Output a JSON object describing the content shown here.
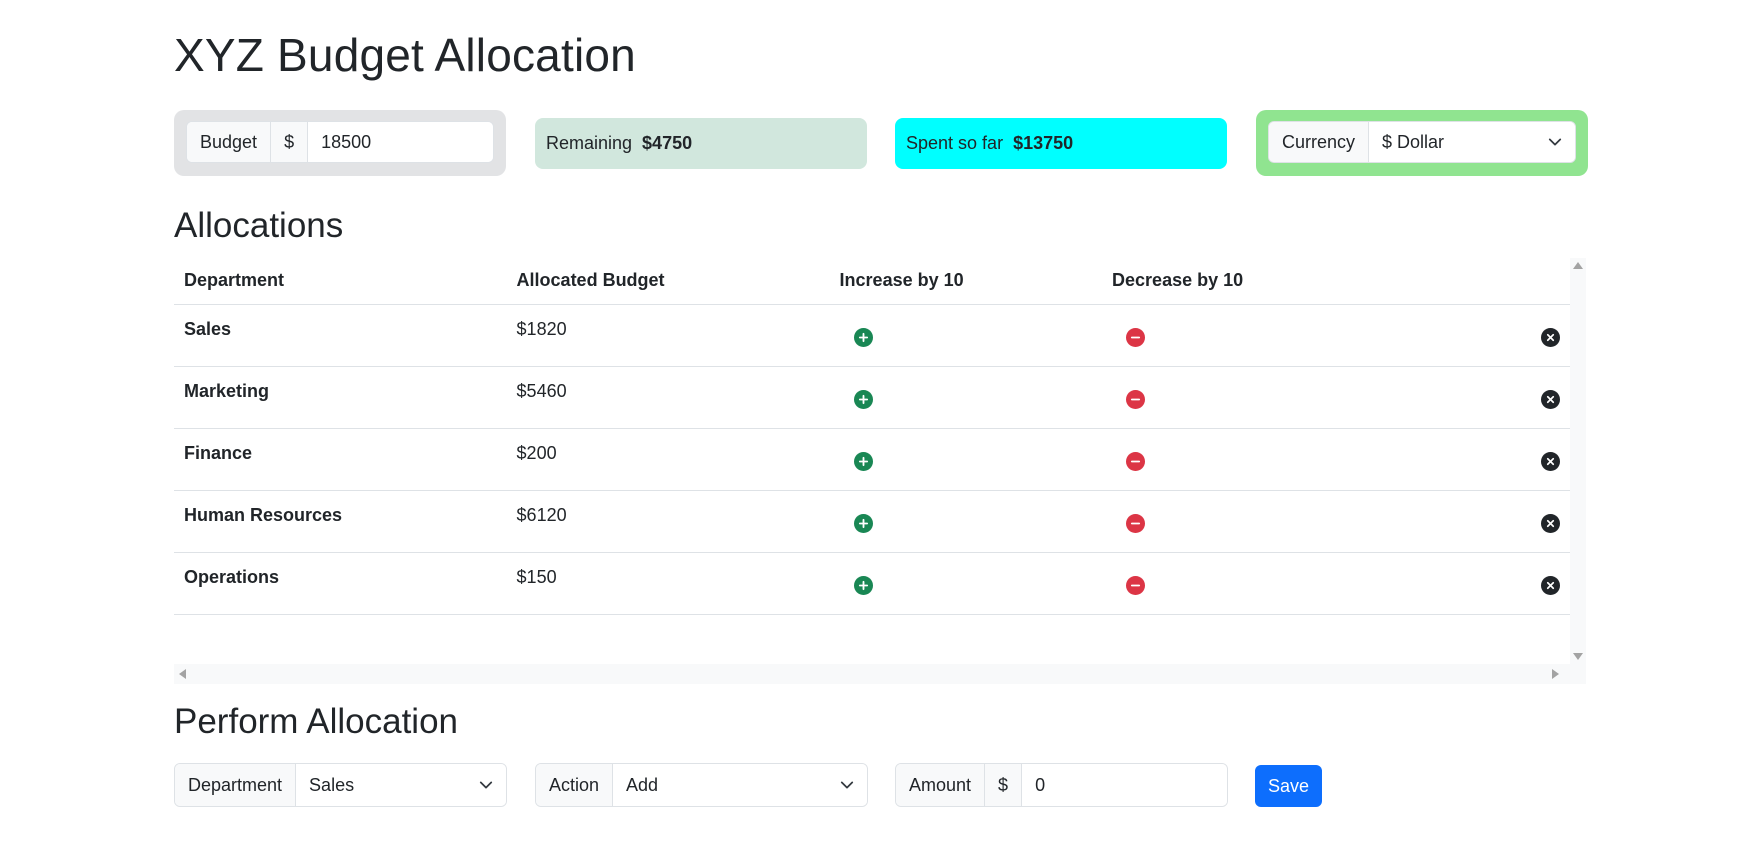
{
  "page": {
    "title": "XYZ Budget Allocation"
  },
  "summary": {
    "budget": {
      "label": "Budget",
      "prefix": "$",
      "value": "18500"
    },
    "remaining": {
      "label": "Remaining",
      "value": "$4750",
      "color": "#d1e7dd"
    },
    "spent": {
      "label": "Spent so far",
      "value": "$13750",
      "color": "#00ffff"
    },
    "currency": {
      "label": "Currency",
      "selected": "$ Dollar",
      "color": "#90e490"
    }
  },
  "allocations": {
    "title": "Allocations",
    "columns": [
      "Department",
      "Allocated Budget",
      "Increase by 10",
      "Decrease by 10"
    ],
    "rows": [
      {
        "department": "Sales",
        "amount": "$1820"
      },
      {
        "department": "Marketing",
        "amount": "$5460"
      },
      {
        "department": "Finance",
        "amount": "$200"
      },
      {
        "department": "Human Resources",
        "amount": "$6120"
      },
      {
        "department": "Operations",
        "amount": "$150"
      }
    ]
  },
  "perform": {
    "title": "Perform Allocation",
    "department": {
      "label": "Department",
      "selected": "Sales"
    },
    "action": {
      "label": "Action",
      "selected": "Add"
    },
    "amount": {
      "label": "Amount",
      "prefix": "$",
      "value": "0"
    },
    "save_label": "Save"
  },
  "icons": {
    "increase": "plus-circle-icon",
    "decrease": "minus-circle-icon",
    "delete": "x-circle-icon",
    "select": "chevron-down-icon"
  },
  "colors": {
    "increase": "#198754",
    "decrease": "#dc3545",
    "delete": "#212529",
    "primary": "#0d6efd"
  }
}
